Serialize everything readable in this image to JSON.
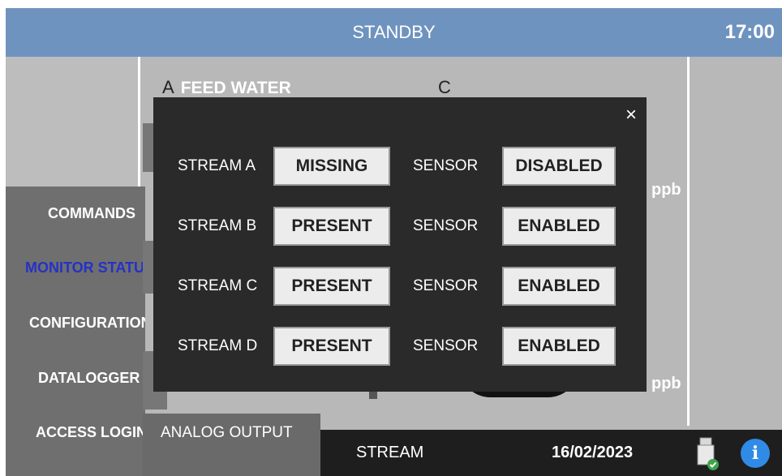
{
  "header": {
    "status": "STANDBY",
    "time": "17:00"
  },
  "main": {
    "stream_a_label": "A",
    "stream_a_name": "FEED WATER",
    "stream_c_label": "C",
    "unit_top": "ppb",
    "unit_bottom": "ppb"
  },
  "menu": {
    "items": [
      {
        "label": "COMMANDS"
      },
      {
        "label": "MONITOR STATUS"
      },
      {
        "label": "CONFIGURATION"
      },
      {
        "label": "DATALOGGER"
      },
      {
        "label": "ACCESS LOGIN"
      }
    ],
    "active_index": 1,
    "submenu_label": "ANALOG OUTPUT"
  },
  "footer": {
    "label": "STREAM",
    "date": "16/02/2023"
  },
  "icons": {
    "usb": "usb-drive-icon",
    "info": "info-icon",
    "close": "close-icon"
  },
  "info_glyph": "i",
  "modal": {
    "close": "×",
    "rows": [
      {
        "stream": "STREAM A",
        "status": "MISSING",
        "sensor_label": "SENSOR",
        "sensor": "DISABLED"
      },
      {
        "stream": "STREAM B",
        "status": "PRESENT",
        "sensor_label": "SENSOR",
        "sensor": "ENABLED"
      },
      {
        "stream": "STREAM C",
        "status": "PRESENT",
        "sensor_label": "SENSOR",
        "sensor": "ENABLED"
      },
      {
        "stream": "STREAM D",
        "status": "PRESENT",
        "sensor_label": "SENSOR",
        "sensor": "ENABLED"
      }
    ]
  },
  "colors": {
    "header": "#6f93bf",
    "menu_active": "#2431c8",
    "info": "#2f8be6",
    "modal": "#2a2a2a"
  }
}
